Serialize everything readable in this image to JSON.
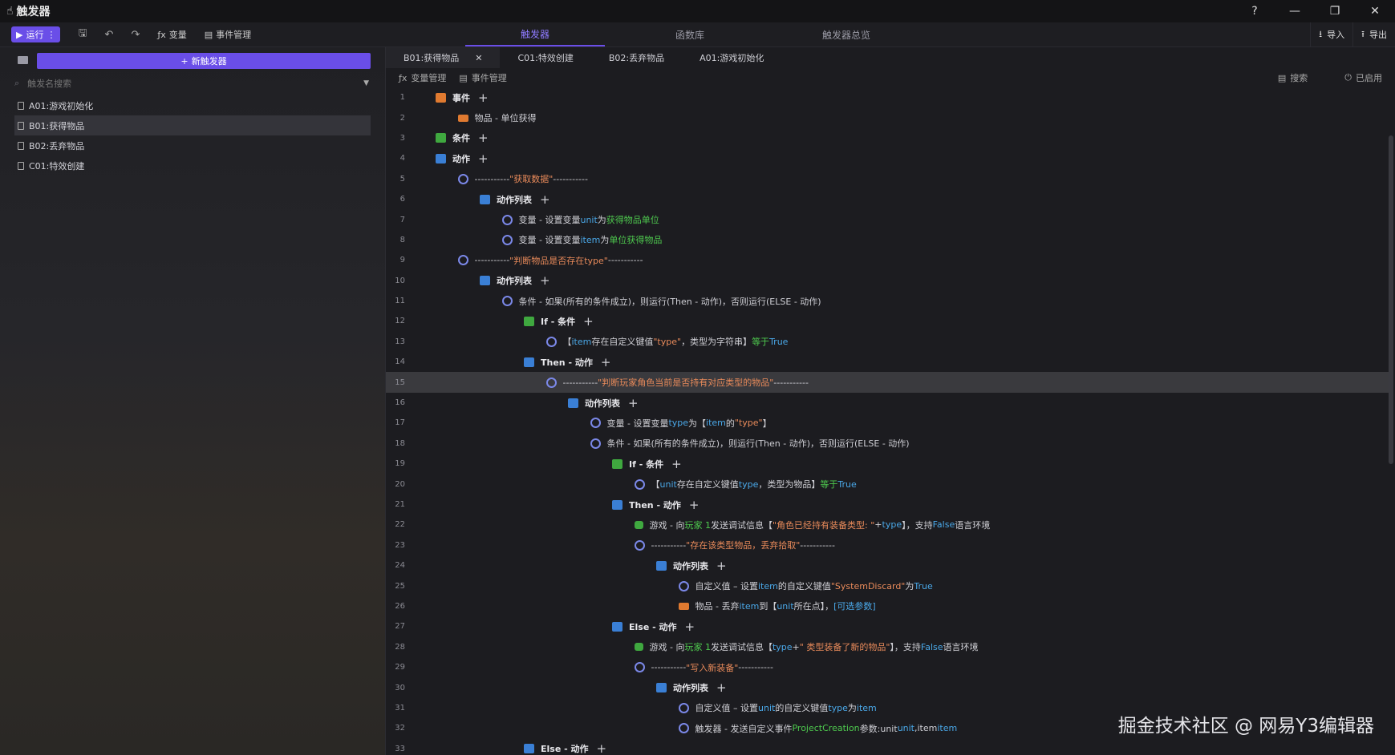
{
  "titlebar": {
    "title": "触发器"
  },
  "toolbar": {
    "run_label": "运行",
    "variables_label": "变量",
    "events_label": "事件管理",
    "tabs": [
      "触发器",
      "函数库",
      "触发器总览"
    ],
    "import_label": "导入",
    "export_label": "导出"
  },
  "sidebar": {
    "new_trigger_label": "新触发器",
    "search_placeholder": "触发名搜索",
    "items": [
      "A01:游戏初始化",
      "B01:获得物品",
      "B02:丢弃物品",
      "C01:特效创建"
    ],
    "selected_index": 1
  },
  "editor": {
    "tabs": [
      "B01:获得物品",
      "C01:特效创建",
      "B02:丢弃物品",
      "A01:游戏初始化"
    ],
    "active_tab_index": 0,
    "var_manage_label": "变量管理",
    "event_manage_label": "事件管理",
    "search_label": "搜索",
    "enabled_label": "已启用",
    "highlighted_line": 15,
    "lines": [
      {
        "n": 1,
        "indent": 0,
        "icon": "evt",
        "parts": [
          {
            "c": "lbl",
            "t": "事件"
          }
        ],
        "plus": true
      },
      {
        "n": 2,
        "indent": 1,
        "icon": "item",
        "parts": [
          {
            "c": "t",
            "t": "物品 - 单位获得"
          }
        ]
      },
      {
        "n": 3,
        "indent": 0,
        "icon": "cond",
        "parts": [
          {
            "c": "lbl",
            "t": "条件"
          }
        ],
        "plus": true
      },
      {
        "n": 4,
        "indent": 0,
        "icon": "act",
        "parts": [
          {
            "c": "lbl",
            "t": "动作"
          }
        ],
        "plus": true
      },
      {
        "n": 5,
        "indent": 1,
        "icon": "node",
        "parts": [
          {
            "c": "t",
            "t": "----------- "
          },
          {
            "c": "s",
            "t": "\"获取数据\""
          },
          {
            "c": "t",
            "t": " -----------"
          }
        ]
      },
      {
        "n": 6,
        "indent": 2,
        "icon": "act",
        "parts": [
          {
            "c": "lbl",
            "t": "动作列表"
          }
        ],
        "plus": true
      },
      {
        "n": 7,
        "indent": 3,
        "icon": "node",
        "parts": [
          {
            "c": "t",
            "t": "变量 - 设置变量 "
          },
          {
            "c": "v",
            "t": "unit"
          },
          {
            "c": "t",
            "t": " 为 "
          },
          {
            "c": "g",
            "t": "获得物品单位"
          }
        ]
      },
      {
        "n": 8,
        "indent": 3,
        "icon": "node",
        "parts": [
          {
            "c": "t",
            "t": "变量 - 设置变量 "
          },
          {
            "c": "v",
            "t": "item"
          },
          {
            "c": "t",
            "t": " 为 "
          },
          {
            "c": "g",
            "t": "单位获得物品"
          }
        ]
      },
      {
        "n": 9,
        "indent": 1,
        "icon": "node",
        "parts": [
          {
            "c": "t",
            "t": "----------- "
          },
          {
            "c": "s",
            "t": "\"判断物品是否存在type\""
          },
          {
            "c": "t",
            "t": " -----------"
          }
        ]
      },
      {
        "n": 10,
        "indent": 2,
        "icon": "act",
        "parts": [
          {
            "c": "lbl",
            "t": "动作列表"
          }
        ],
        "plus": true
      },
      {
        "n": 11,
        "indent": 3,
        "icon": "node",
        "parts": [
          {
            "c": "t",
            "t": "条件 - 如果(所有的条件成立)，则运行(Then - 动作)，否则运行(ELSE - 动作)"
          }
        ]
      },
      {
        "n": 12,
        "indent": 4,
        "icon": "cond",
        "parts": [
          {
            "c": "lbl",
            "t": "If - 条件"
          }
        ],
        "plus": true
      },
      {
        "n": 13,
        "indent": 5,
        "icon": "node",
        "parts": [
          {
            "c": "t",
            "t": "【 "
          },
          {
            "c": "v",
            "t": "item"
          },
          {
            "c": "t",
            "t": " 存在自定义键值 "
          },
          {
            "c": "s",
            "t": "\"type\""
          },
          {
            "c": "t",
            "t": " ，类型为字符串】 "
          },
          {
            "c": "g",
            "t": "等于"
          },
          {
            "c": "k",
            "t": "  True"
          }
        ]
      },
      {
        "n": 14,
        "indent": 4,
        "icon": "act",
        "parts": [
          {
            "c": "lbl",
            "t": "Then - 动作"
          }
        ],
        "plus": true
      },
      {
        "n": 15,
        "indent": 5,
        "icon": "node",
        "parts": [
          {
            "c": "t",
            "t": "----------- "
          },
          {
            "c": "s",
            "t": "\"判断玩家角色当前是否持有对应类型的物品\""
          },
          {
            "c": "t",
            "t": " -----------"
          }
        ]
      },
      {
        "n": 16,
        "indent": 6,
        "icon": "act",
        "parts": [
          {
            "c": "lbl",
            "t": "动作列表"
          }
        ],
        "plus": true
      },
      {
        "n": 17,
        "indent": 7,
        "icon": "node",
        "parts": [
          {
            "c": "t",
            "t": "变量 - 设置变量 "
          },
          {
            "c": "v",
            "t": "type"
          },
          {
            "c": "t",
            "t": " 为【 "
          },
          {
            "c": "v",
            "t": "item"
          },
          {
            "c": "t",
            "t": " 的 "
          },
          {
            "c": "s",
            "t": "\"type\""
          },
          {
            "c": "t",
            "t": " 】"
          }
        ]
      },
      {
        "n": 18,
        "indent": 7,
        "icon": "node",
        "parts": [
          {
            "c": "t",
            "t": "条件 - 如果(所有的条件成立)，则运行(Then - 动作)，否则运行(ELSE - 动作)"
          }
        ]
      },
      {
        "n": 19,
        "indent": 8,
        "icon": "cond",
        "parts": [
          {
            "c": "lbl",
            "t": "If - 条件"
          }
        ],
        "plus": true
      },
      {
        "n": 20,
        "indent": 9,
        "icon": "node",
        "parts": [
          {
            "c": "t",
            "t": "【 "
          },
          {
            "c": "v",
            "t": "unit"
          },
          {
            "c": "t",
            "t": " 存在自定义键值 "
          },
          {
            "c": "v",
            "t": "type"
          },
          {
            "c": "t",
            "t": " ，类型为物品】 "
          },
          {
            "c": "g",
            "t": "等于"
          },
          {
            "c": "k",
            "t": "  True"
          }
        ]
      },
      {
        "n": 21,
        "indent": 8,
        "icon": "act",
        "parts": [
          {
            "c": "lbl",
            "t": "Then - 动作"
          }
        ],
        "plus": true
      },
      {
        "n": 22,
        "indent": 9,
        "icon": "game",
        "parts": [
          {
            "c": "t",
            "t": "游戏 - 向 "
          },
          {
            "c": "g",
            "t": "玩家 1"
          },
          {
            "c": "t",
            "t": " 发送调试信息【 "
          },
          {
            "c": "s",
            "t": "\"角色已经持有装备类型: \""
          },
          {
            "c": "t",
            "t": " + "
          },
          {
            "c": "v",
            "t": "type"
          },
          {
            "c": "t",
            "t": " 】，支持 "
          },
          {
            "c": "k",
            "t": "False"
          },
          {
            "c": "t",
            "t": " 语言环境"
          }
        ]
      },
      {
        "n": 23,
        "indent": 9,
        "icon": "node",
        "parts": [
          {
            "c": "t",
            "t": "----------- "
          },
          {
            "c": "s",
            "t": "\"存在该类型物品，丢弃拾取\""
          },
          {
            "c": "t",
            "t": " -----------"
          }
        ]
      },
      {
        "n": 24,
        "indent": 10,
        "icon": "act",
        "parts": [
          {
            "c": "lbl",
            "t": "动作列表"
          }
        ],
        "plus": true
      },
      {
        "n": 25,
        "indent": 11,
        "icon": "node",
        "parts": [
          {
            "c": "t",
            "t": "自定义值 – 设置 "
          },
          {
            "c": "v",
            "t": "item"
          },
          {
            "c": "t",
            "t": " 的自定义键值 "
          },
          {
            "c": "s",
            "t": "\"SystemDiscard\""
          },
          {
            "c": "t",
            "t": " 为 "
          },
          {
            "c": "k",
            "t": "True"
          }
        ]
      },
      {
        "n": 26,
        "indent": 11,
        "icon": "item",
        "parts": [
          {
            "c": "t",
            "t": "物品 - 丢弃 "
          },
          {
            "c": "v",
            "t": "item"
          },
          {
            "c": "t",
            "t": " 到【 "
          },
          {
            "c": "v",
            "t": "unit"
          },
          {
            "c": "t",
            "t": " 所在点】，"
          },
          {
            "c": "k",
            "t": "[可选参数]"
          }
        ]
      },
      {
        "n": 27,
        "indent": 8,
        "icon": "act",
        "parts": [
          {
            "c": "lbl",
            "t": "Else - 动作"
          }
        ],
        "plus": true
      },
      {
        "n": 28,
        "indent": 9,
        "icon": "game",
        "parts": [
          {
            "c": "t",
            "t": "游戏 - 向 "
          },
          {
            "c": "g",
            "t": "玩家 1"
          },
          {
            "c": "t",
            "t": " 发送调试信息【 "
          },
          {
            "c": "v",
            "t": "type"
          },
          {
            "c": "t",
            "t": " + "
          },
          {
            "c": "s",
            "t": "\" 类型装备了新的物品\""
          },
          {
            "c": "t",
            "t": " 】，支持 "
          },
          {
            "c": "k",
            "t": "False"
          },
          {
            "c": "t",
            "t": " 语言环境"
          }
        ]
      },
      {
        "n": 29,
        "indent": 9,
        "icon": "node",
        "parts": [
          {
            "c": "t",
            "t": "----------- "
          },
          {
            "c": "s",
            "t": "\"写入新装备\""
          },
          {
            "c": "t",
            "t": " -----------"
          }
        ]
      },
      {
        "n": 30,
        "indent": 10,
        "icon": "act",
        "parts": [
          {
            "c": "lbl",
            "t": "动作列表"
          }
        ],
        "plus": true
      },
      {
        "n": 31,
        "indent": 11,
        "icon": "node",
        "parts": [
          {
            "c": "t",
            "t": "自定义值 – 设置 "
          },
          {
            "c": "v",
            "t": "unit"
          },
          {
            "c": "t",
            "t": " 的自定义键值 "
          },
          {
            "c": "v",
            "t": "type"
          },
          {
            "c": "t",
            "t": " 为 "
          },
          {
            "c": "v",
            "t": "item"
          }
        ]
      },
      {
        "n": 32,
        "indent": 11,
        "icon": "node",
        "parts": [
          {
            "c": "t",
            "t": "触发器 - 发送自定义事件 "
          },
          {
            "c": "g",
            "t": "ProjectCreation"
          },
          {
            "c": "t",
            "t": " 参数:unit "
          },
          {
            "c": "v",
            "t": "unit"
          },
          {
            "c": "t",
            "t": " ,item "
          },
          {
            "c": "v",
            "t": "item"
          }
        ]
      },
      {
        "n": 33,
        "indent": 4,
        "icon": "act",
        "parts": [
          {
            "c": "lbl",
            "t": "Else - 动作"
          }
        ],
        "plus": true
      }
    ]
  },
  "watermark": "掘金技术社区 @ 网易Y3编辑器",
  "colors": {
    "accent": "#6a4ee8",
    "string": "#e88a5a",
    "variable": "#4aa8e8",
    "function": "#4ec94e"
  }
}
